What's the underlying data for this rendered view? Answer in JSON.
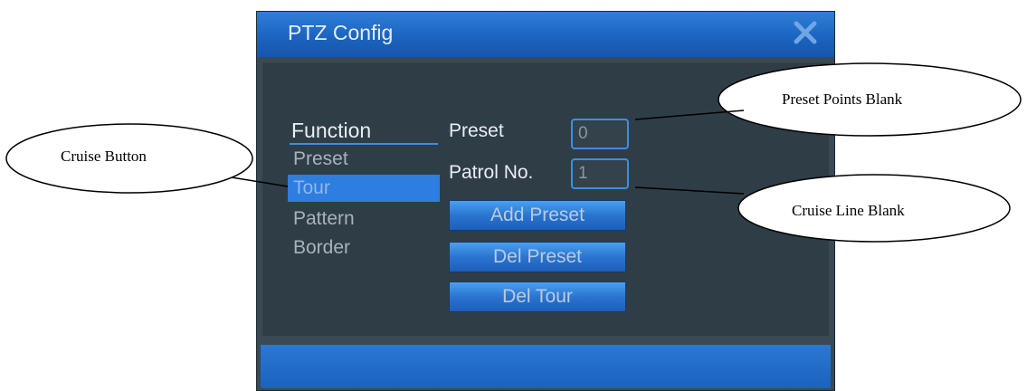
{
  "dialog": {
    "title": "PTZ Config",
    "close_icon": "close-icon"
  },
  "menu": {
    "header": "Function",
    "items": [
      {
        "label": "Preset",
        "selected": false
      },
      {
        "label": "Tour",
        "selected": true
      },
      {
        "label": "Pattern",
        "selected": false
      },
      {
        "label": "Border",
        "selected": false
      }
    ]
  },
  "form": {
    "preset_label": "Preset",
    "preset_value": "0",
    "patrol_label": "Patrol No.",
    "patrol_value": "1",
    "add_preset_label": "Add Preset",
    "del_preset_label": "Del Preset",
    "del_tour_label": "Del Tour"
  },
  "callouts": {
    "preset_points": "Preset Points Blank",
    "cruise_button": "Cruise Button",
    "cruise_line": "Cruise Line Blank"
  },
  "colors": {
    "titlebar": "#1b64c0",
    "panel": "#2f3d46",
    "accent": "#2d7ee0",
    "field_border": "#3b8fe0"
  }
}
